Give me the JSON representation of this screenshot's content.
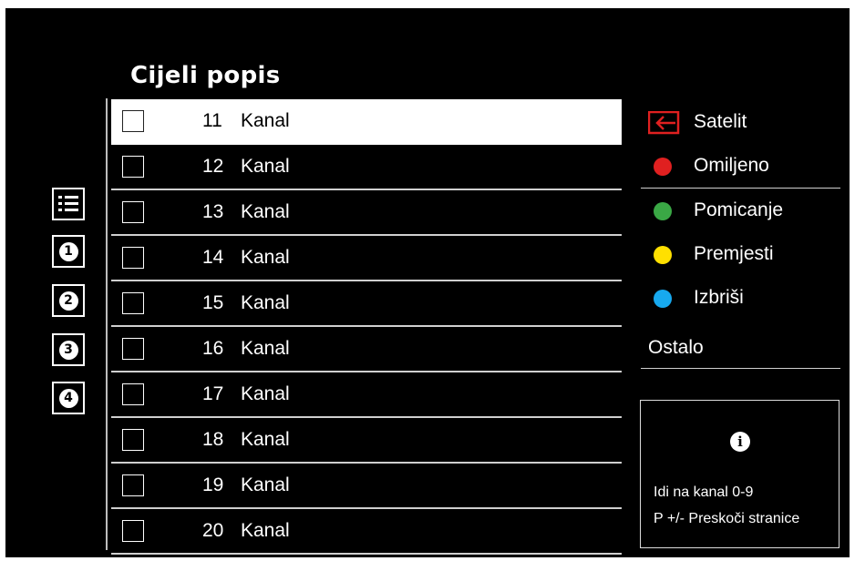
{
  "title": "Cijeli popis",
  "channels": [
    {
      "number": "11",
      "name": "Kanal",
      "selected": true
    },
    {
      "number": "12",
      "name": "Kanal"
    },
    {
      "number": "13",
      "name": "Kanal"
    },
    {
      "number": "14",
      "name": "Kanal"
    },
    {
      "number": "15",
      "name": "Kanal"
    },
    {
      "number": "16",
      "name": "Kanal"
    },
    {
      "number": "17",
      "name": "Kanal"
    },
    {
      "number": "18",
      "name": "Kanal"
    },
    {
      "number": "19",
      "name": "Kanal"
    },
    {
      "number": "20",
      "name": "Kanal"
    }
  ],
  "sidebar": {
    "icons": [
      {
        "name": "list-icon"
      },
      {
        "name": "number-1-icon",
        "glyph": "1"
      },
      {
        "name": "number-2-icon",
        "glyph": "2"
      },
      {
        "name": "number-3-icon",
        "glyph": "3"
      },
      {
        "name": "number-4-icon",
        "glyph": "4"
      }
    ]
  },
  "right_menu": {
    "source_label": "Satelit",
    "source_icon": "input-source-icon",
    "source_color": "#e02020",
    "options": [
      {
        "label": "Omiljeno",
        "color": "#e02020",
        "icon": "red-dot-icon"
      },
      {
        "label": "Pomicanje",
        "color": "#3aa845",
        "icon": "green-dot-icon"
      },
      {
        "label": "Premjesti",
        "color": "#ffe000",
        "icon": "yellow-dot-icon"
      },
      {
        "label": "Izbriši",
        "color": "#17a9ef",
        "icon": "blue-dot-icon"
      }
    ],
    "other_label": "Ostalo"
  },
  "info_box": {
    "icon": "info-icon",
    "line1": "Idi na kanal 0-9",
    "line2": "P +/- Preskoči stranice"
  }
}
